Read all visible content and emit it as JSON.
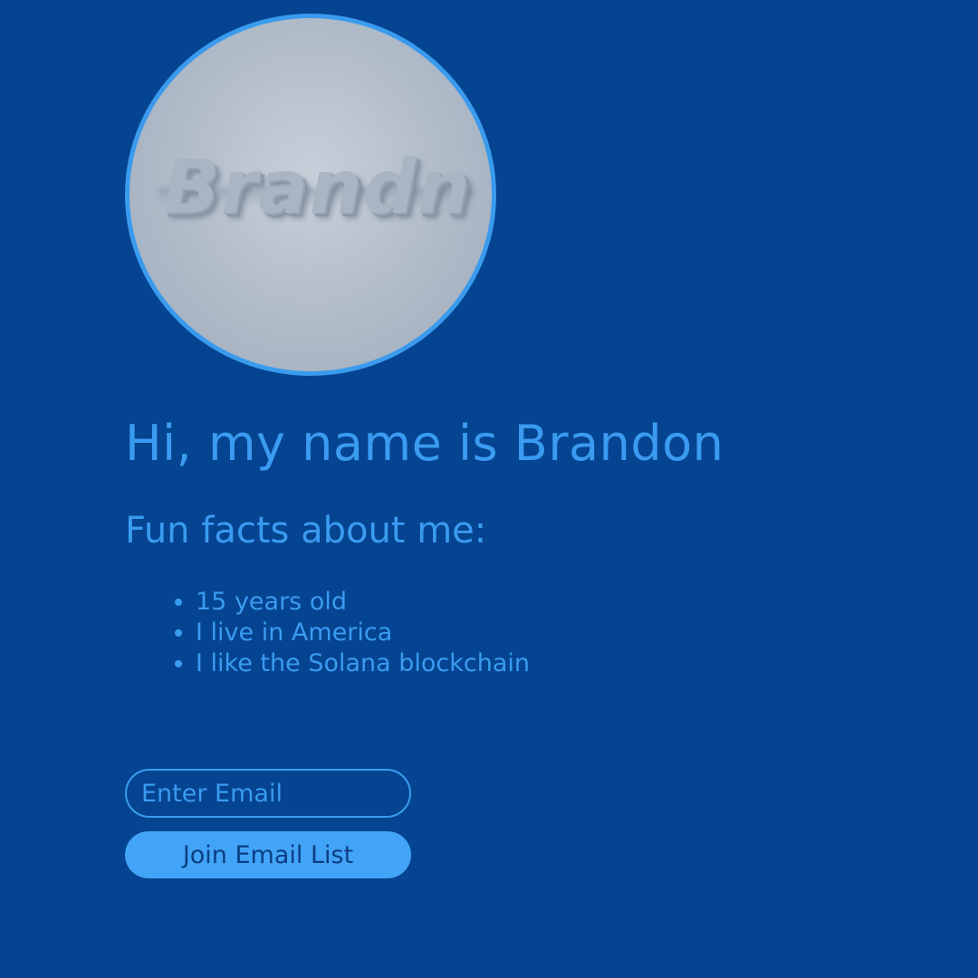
{
  "profile": {
    "image_alt": "Brandn",
    "logo_text": "Brandn"
  },
  "heading": {
    "title": "Hi, my name is Brandon",
    "subtitle": "Fun facts about me:"
  },
  "facts": [
    "15 years old",
    "I live in America",
    "I like the Solana blockchain"
  ],
  "email_form": {
    "placeholder": "Enter Email",
    "value": "",
    "button_label": "Join Email List"
  },
  "colors": {
    "background": "#054491",
    "accent": "#3a9bf0",
    "button_bg": "#42a4f7",
    "button_text": "#0b3e82"
  }
}
